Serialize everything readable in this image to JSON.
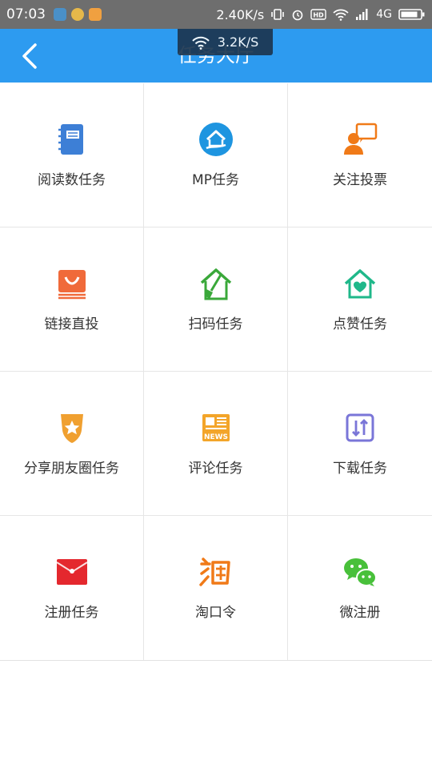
{
  "status_bar": {
    "time": "07:03",
    "net_speed": "2.40K/s",
    "network": "4G"
  },
  "header": {
    "title": "任务大厅",
    "back_icon": "chevron-left-icon",
    "bg_color": "#2d9bf0"
  },
  "toast": {
    "speed": "3.2K/S",
    "icon": "wifi-icon"
  },
  "tasks": [
    {
      "label": "阅读数任务",
      "icon": "notebook-icon",
      "color": "#3d7fd6"
    },
    {
      "label": "MP任务",
      "icon": "home-hand-icon",
      "color": "#1e95e0"
    },
    {
      "label": "关注投票",
      "icon": "user-chat-icon",
      "color": "#f07a18"
    },
    {
      "label": "链接直投",
      "icon": "mail-link-icon",
      "color": "#f06a3a"
    },
    {
      "label": "扫码任务",
      "icon": "house-broom-icon",
      "color": "#3aa83a"
    },
    {
      "label": "点赞任务",
      "icon": "house-heart-icon",
      "color": "#1fb88a"
    },
    {
      "label": "分享朋友圈任务",
      "icon": "star-badge-icon",
      "color": "#f0a030"
    },
    {
      "label": "评论任务",
      "icon": "news-icon",
      "color": "#f3a52a"
    },
    {
      "label": "下载任务",
      "icon": "download-arrows-icon",
      "color": "#7a76d8"
    },
    {
      "label": "注册任务",
      "icon": "red-envelope-icon",
      "color": "#e4282e"
    },
    {
      "label": "淘口令",
      "icon": "taobao-icon",
      "color": "#f07a18"
    },
    {
      "label": "微注册",
      "icon": "wechat-icon",
      "color": "#48c03a"
    }
  ]
}
